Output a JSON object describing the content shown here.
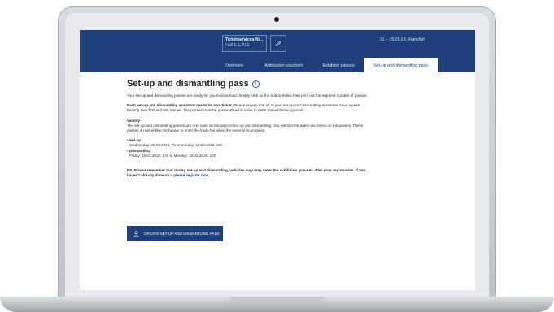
{
  "header": {
    "ticket_title": "Ticketservices fü...",
    "ticket_sub": "Hall 1.1, A01",
    "date_location": "11. - 15.03.19, Frankfurt"
  },
  "tabs": [
    {
      "label": "Overview",
      "active": false
    },
    {
      "label": "Admission vouchers",
      "active": false
    },
    {
      "label": "Exhibitor passes",
      "active": false
    },
    {
      "label": "Set-up and dismantling pass",
      "active": true
    }
  ],
  "main": {
    "title": "Set-up and dismantling pass",
    "intro": "Your set-up and dismantling passes are ready for you to download. Simply click on the button below then print out the required number of passes.",
    "ticket_notice_bold": "Each set-up and dismantling assistant needs its own ticket.",
    "ticket_notice_rest": " Please ensure that all of your set-up and dismantling assistants have a pass bearing their first and last names. The passes must be personalised in order to enter the exhibition grounds.",
    "validity_heading": "Validity",
    "validity_text": "The set-up and dismantling passes are only valid on the days of set-up and dismantling. You will find the dates and times on the passes. These passes do not entitle the bearer to enter the trade fair when the event is in progress.",
    "setup_label": "• Set-up",
    "setup_dates": "Wednesday, 06.03.2019, 7h to Sunday, 10.03.2019, 15h",
    "dismantling_label": "• Dismantling",
    "dismantling_dates": "Friday, 15.03.2019, 17h to Monday, 18.03.2019, 24h",
    "ps_text": "PS: Please remember that during set-up and dismantling, vehicles may only enter the exhibition grounds after prior registration. If you haven't already done so – ",
    "ps_link": "please register now.",
    "cta_label": "CREATE SET-UP AND DISMANTLING PASS"
  },
  "colors": {
    "brand": "#1f3f7a",
    "info": "#2f58b8"
  },
  "icons": [
    "edit-pencil-icon",
    "info-icon",
    "person-icon"
  ]
}
